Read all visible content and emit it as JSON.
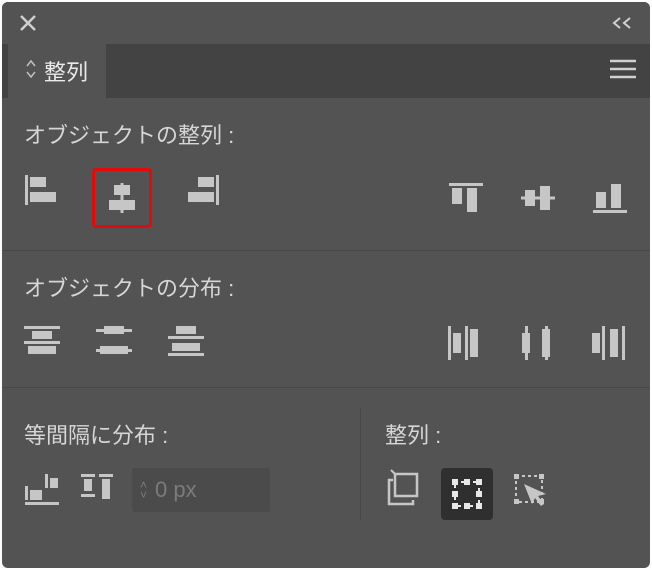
{
  "panel": {
    "tab_label": "整列"
  },
  "sections": {
    "align_label": "オブジェクトの整列 :",
    "distribute_label": "オブジェクトの分布 :",
    "spacing_label": "等間隔に分布 :",
    "align_to_label": "整列 :"
  },
  "spacing": {
    "value": "0 px"
  },
  "icons": {
    "align": {
      "left": "align-left",
      "hcenter": "align-hcenter",
      "right": "align-right",
      "top": "align-top",
      "vcenter": "align-vcenter",
      "bottom": "align-bottom"
    },
    "distribute": {
      "top": "dist-top",
      "vcenter": "dist-vcenter",
      "bottom": "dist-bottom",
      "left": "dist-left",
      "hcenter": "dist-hcenter",
      "right": "dist-right"
    },
    "spacing": {
      "horizontal": "space-horizontal",
      "vertical": "space-vertical"
    },
    "align_to": {
      "artboard": "align-to-artboard",
      "selection": "align-to-selection",
      "key_object": "align-to-key-object"
    }
  },
  "colors": {
    "panel_bg": "#535353",
    "tab_bg": "#434343",
    "icon": "#c6c6c6",
    "highlight": "#e20b0b"
  }
}
